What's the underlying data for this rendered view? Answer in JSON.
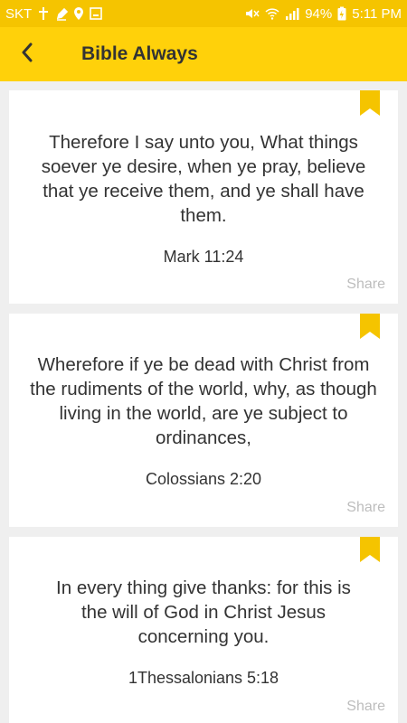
{
  "status_bar": {
    "carrier": "SKT",
    "battery": "94%",
    "time": "5:11 PM"
  },
  "app_bar": {
    "title": "Bible Always",
    "back_icon": "chevron-left-icon"
  },
  "colors": {
    "status_bar": "#f5c400",
    "app_bar": "#ffd10a",
    "bookmark": "#f5c400",
    "share_text": "#bdbdbd"
  },
  "cards": [
    {
      "verse": "Therefore I say unto you, What things soever ye desire, when ye pray, believe that ye receive them, and ye shall have them.",
      "reference": "Mark 11:24",
      "share_label": "Share"
    },
    {
      "verse": "Wherefore if ye be dead with Christ from the rudiments of the world, why, as though living in the world, are ye subject to ordinances,",
      "reference": "Colossians 2:20",
      "share_label": "Share"
    },
    {
      "verse": "In every thing give thanks: for this is the will of God in Christ Jesus concerning you.",
      "reference": "1Thessalonians 5:18",
      "share_label": "Share"
    }
  ]
}
